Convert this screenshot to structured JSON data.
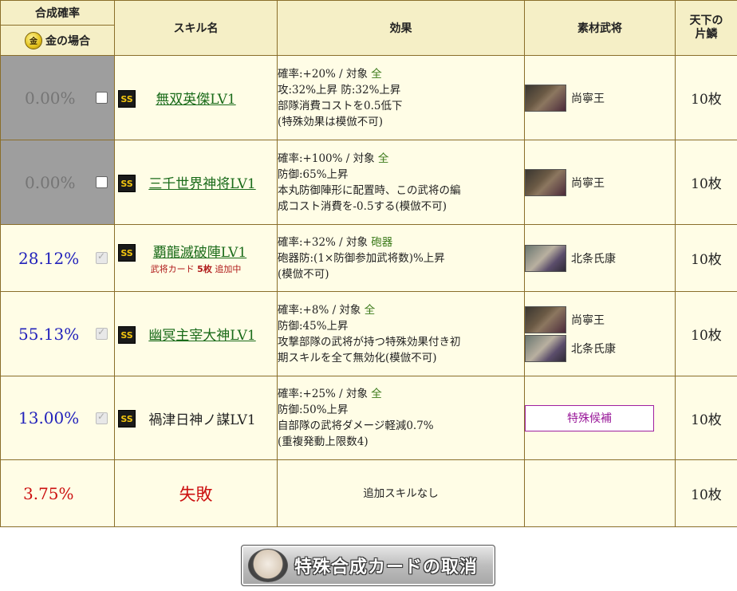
{
  "header": {
    "rate_title": "合成確率",
    "rate_sub": "金の場合",
    "gold_icon_text": "金",
    "skill": "スキル名",
    "effect": "効果",
    "material": "素材武将",
    "cost_line1": "天下の",
    "cost_line2": "片鱗"
  },
  "rows": [
    {
      "rate": "0.00%",
      "badge": "SS",
      "skill": "無双英傑LV1",
      "effect_prefix": "確率:+20%  /  対象 ",
      "effect_target": "全",
      "effect_lines": [
        "攻:32%上昇 防:32%上昇",
        "部隊消費コストを0.5低下",
        "(特殊効果は模倣不可)"
      ],
      "materials": [
        "尚寧王"
      ],
      "cost": "10枚"
    },
    {
      "rate": "0.00%",
      "badge": "SS",
      "skill": "三千世界神将LV1",
      "effect_prefix": "確率:+100%  /  対象 ",
      "effect_target": "全",
      "effect_lines": [
        "防御:65%上昇",
        "本丸防御陣形に配置時、この武将の編",
        "成コスト消費を-0.5する(模倣不可)"
      ],
      "materials": [
        "尚寧王"
      ],
      "cost": "10枚"
    },
    {
      "rate": "28.12%",
      "badge": "SS",
      "skill": "覇龍滅破陣LV1",
      "sub_prefix": "武将カード ",
      "sub_count": "5枚",
      "sub_suffix": " 追加中",
      "effect_prefix": "確率:+32%  /  対象 ",
      "effect_target": "砲器",
      "effect_lines": [
        "砲器防:(1×防御参加武将数)%上昇",
        "(模倣不可)"
      ],
      "materials": [
        "北条氏康"
      ],
      "cost": "10枚"
    },
    {
      "rate": "55.13%",
      "badge": "SS",
      "skill": "幽冥主宰大神LV1",
      "effect_prefix": "確率:+8%  /  対象 ",
      "effect_target": "全",
      "effect_lines": [
        "防御:45%上昇",
        "攻撃部隊の武将が持つ特殊効果付き初",
        "期スキルを全て無効化(模倣不可)"
      ],
      "materials": [
        "尚寧王",
        "北条氏康"
      ],
      "cost": "10枚"
    },
    {
      "rate": "13.00%",
      "badge": "SS",
      "skill": "禍津日神ノ謀LV1",
      "effect_prefix": "確率:+25%  /  対象 ",
      "effect_target": "全",
      "effect_lines": [
        "防御:50%上昇",
        "自部隊の武将ダメージ軽減0.7%",
        "(重複発動上限数4)"
      ],
      "special_button": "特殊候補",
      "cost": "10枚"
    },
    {
      "rate": "3.75%",
      "skill": "失敗",
      "effect_single": "追加スキルなし",
      "cost": "10枚"
    }
  ],
  "footer": {
    "cancel_button": "特殊合成カードの取消"
  }
}
